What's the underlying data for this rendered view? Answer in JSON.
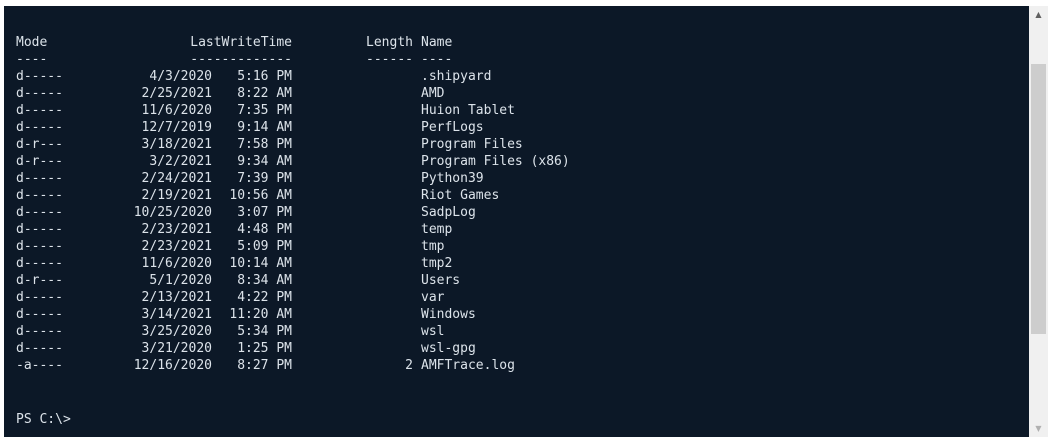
{
  "terminal": {
    "headers": {
      "mode": "Mode",
      "lastwritetime": "LastWriteTime",
      "length": "Length",
      "name": "Name"
    },
    "underlines": {
      "mode": "----",
      "lastwritetime": "-------------",
      "length": "------",
      "name": "----"
    },
    "rows": [
      {
        "mode": "d-----",
        "date": "4/3/2020",
        "time": "5:16 PM",
        "length": "",
        "name": ".shipyard"
      },
      {
        "mode": "d-----",
        "date": "2/25/2021",
        "time": "8:22 AM",
        "length": "",
        "name": "AMD"
      },
      {
        "mode": "d-----",
        "date": "11/6/2020",
        "time": "7:35 PM",
        "length": "",
        "name": "Huion Tablet"
      },
      {
        "mode": "d-----",
        "date": "12/7/2019",
        "time": "9:14 AM",
        "length": "",
        "name": "PerfLogs"
      },
      {
        "mode": "d-r---",
        "date": "3/18/2021",
        "time": "7:58 PM",
        "length": "",
        "name": "Program Files"
      },
      {
        "mode": "d-r---",
        "date": "3/2/2021",
        "time": "9:34 AM",
        "length": "",
        "name": "Program Files (x86)"
      },
      {
        "mode": "d-----",
        "date": "2/24/2021",
        "time": "7:39 PM",
        "length": "",
        "name": "Python39"
      },
      {
        "mode": "d-----",
        "date": "2/19/2021",
        "time": "10:56 AM",
        "length": "",
        "name": "Riot Games"
      },
      {
        "mode": "d-----",
        "date": "10/25/2020",
        "time": "3:07 PM",
        "length": "",
        "name": "SadpLog"
      },
      {
        "mode": "d-----",
        "date": "2/23/2021",
        "time": "4:48 PM",
        "length": "",
        "name": "temp"
      },
      {
        "mode": "d-----",
        "date": "2/23/2021",
        "time": "5:09 PM",
        "length": "",
        "name": "tmp"
      },
      {
        "mode": "d-----",
        "date": "11/6/2020",
        "time": "10:14 AM",
        "length": "",
        "name": "tmp2"
      },
      {
        "mode": "d-r---",
        "date": "5/1/2020",
        "time": "8:34 AM",
        "length": "",
        "name": "Users"
      },
      {
        "mode": "d-----",
        "date": "2/13/2021",
        "time": "4:22 PM",
        "length": "",
        "name": "var"
      },
      {
        "mode": "d-----",
        "date": "3/14/2021",
        "time": "11:20 AM",
        "length": "",
        "name": "Windows"
      },
      {
        "mode": "d-----",
        "date": "3/25/2020",
        "time": "5:34 PM",
        "length": "",
        "name": "wsl"
      },
      {
        "mode": "d-----",
        "date": "3/21/2020",
        "time": "1:25 PM",
        "length": "",
        "name": "wsl-gpg"
      },
      {
        "mode": "-a----",
        "date": "12/16/2020",
        "time": "8:27 PM",
        "length": "2",
        "name": "AMFTrace.log"
      }
    ],
    "prompt": "PS C:\\>"
  },
  "scrollbar": {
    "up_icon": "chevron-up-icon",
    "down_icon": "chevron-down-icon",
    "scroll_position": 0.32
  },
  "colors": {
    "background": "#0c1827",
    "foreground": "#dce3ea",
    "scrollbar_track": "#f0f0f0",
    "scrollbar_thumb": "#cdcdcd"
  }
}
